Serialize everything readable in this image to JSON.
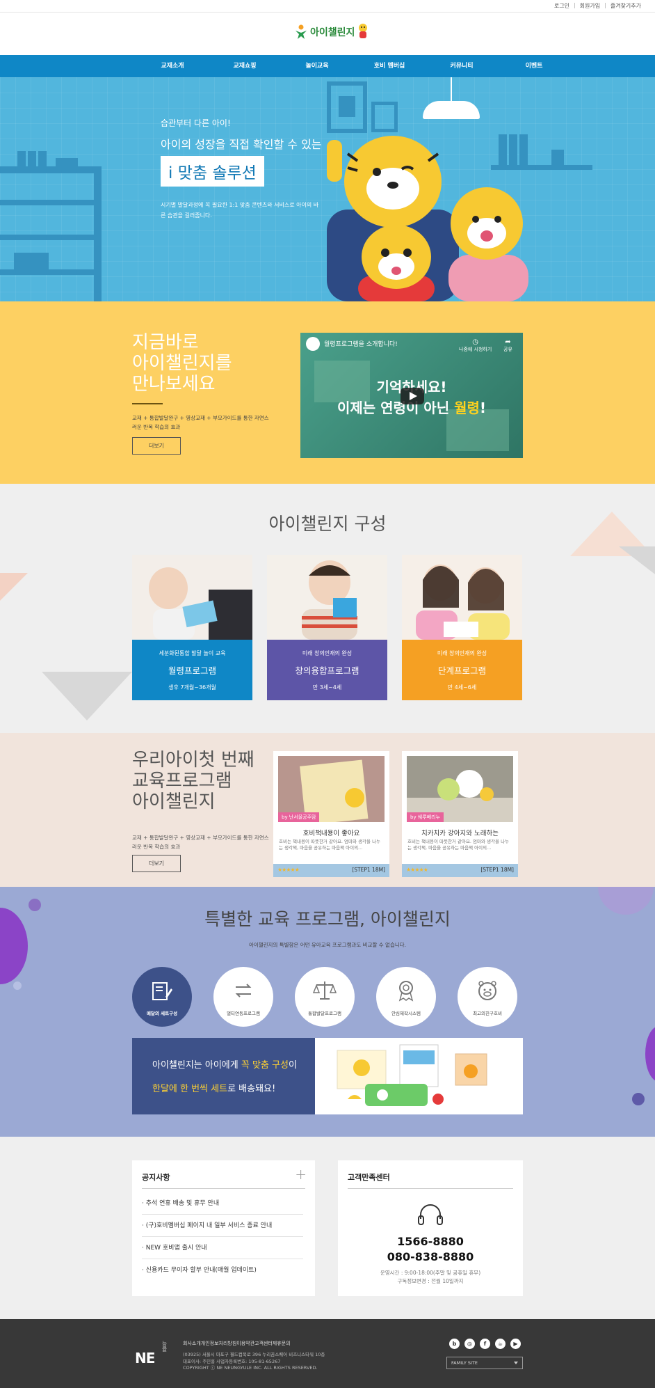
{
  "util": {
    "login": "로그인",
    "join": "회원가입",
    "bookmark": "즐겨찾기추가"
  },
  "logo": {
    "text": "아이챌린지"
  },
  "nav": {
    "items": [
      "교재소개",
      "교재쇼핑",
      "놀이교육",
      "호비 멤버십",
      "커뮤니티",
      "이벤트"
    ]
  },
  "hero": {
    "sub1": "습관부터 다른 아이!",
    "sub2": "아이의 성장을 직접 확인할 수 있는",
    "box": "i 맞춤 솔루션",
    "desc": "시기별 발달과정에 꼭 필요한 1:1 맞춤 콘텐츠와 서비스로 아이의 바른 습관을 길러줍니다."
  },
  "video_section": {
    "title_lines": [
      "지금바로",
      "아이챌린지를",
      "만나보세요"
    ],
    "desc": "교재 + 통합발달완구 + 영상교재 + 부모가이드를 통한 자연스러운 반복 학습의 효과",
    "more": "더보기",
    "video": {
      "title": "월령프로그램을 소개합니다!",
      "watch_later": "나중에 시청하기",
      "share": "공유",
      "big_line1": "기억하세요!",
      "big_line2_a": "이제는 연령이 아닌 ",
      "big_line2_b": "월령",
      "big_line2_c": "!"
    }
  },
  "composition": {
    "title": "아이챌린지 구성",
    "cards": [
      {
        "sub": "세분화된통합 발달 놀이 교육",
        "name": "월령프로그램",
        "age": "생후 7개월~36개월",
        "color": "#0f87c6"
      },
      {
        "sub": "미래 창의인재의 완성",
        "name": "창의융합프로그램",
        "age": "만 3세~4세",
        "color": "#5d55a7"
      },
      {
        "sub": "미래 창의인재의 완성",
        "name": "단계프로그램",
        "age": "만 4세~6세",
        "color": "#f5a023"
      }
    ]
  },
  "first_program": {
    "title_lines": [
      "우리아이첫 번째",
      "교육프로그램",
      "아이챌린지"
    ],
    "desc": "교재 + 통합발달완구 + 영상교재 + 부모가이드를 통한 자연스러운 반복 학습의 효과",
    "more": "더보기",
    "books": [
      {
        "tag": "by 난서울공주맘",
        "title": "호비책내용이 좋아요",
        "desc": "호비는 책내용이 따뜻한거 같아요. 엄마와 생각을 나누는 생각책, 마음을 공유하는 마음책 아이의...",
        "stars": "★★★★★",
        "step": "[STEP1 18M]"
      },
      {
        "tag": "by 쉐루베리누",
        "title": "치카치카 강아지와 노래하는",
        "desc": "호비는 책내용이 따뜻한거 같아요. 엄마와 생각을 나누는 생각책, 마음을 공유하는 마음책 아이의...",
        "stars": "★★★★★",
        "step": "[STEP1 18M]"
      }
    ]
  },
  "special": {
    "title": "특별한 교육 프로그램, 아이챌린지",
    "subtitle": "아이챌린지의 특별함은 어떤 유아교육 프로그램과도 비교할 수 없습니다.",
    "features": [
      "매달의 세트구성",
      "멀티연동프로그램",
      "통합발달프로그램",
      "안심제작시스템",
      "최고의친구호비"
    ],
    "banner_l1_a": "아이챌린지는 아이에게 ",
    "banner_l1_b": "꼭 맞춤 구성",
    "banner_l1_c": "이",
    "banner_l2_a": "한달에 한 번씩 세트",
    "banner_l2_b": "로 배송돼요!"
  },
  "notice": {
    "title": "공지사항",
    "plus": "+",
    "items": [
      "· 추석 연휴 배송 및 휴무 안내",
      "· (구)호비멤버십 페이지 내 일부 서비스 종료 안내",
      "· NEW 호비앱 출시 안내",
      "· 신용카드 무이자 할부 안내(매월 업데이트)"
    ]
  },
  "cs": {
    "title": "고객만족센터",
    "phone1": "1566-8880",
    "phone2": "080-838-8880",
    "hours": "운영시간 : 9:00-18:00(주말 및 공휴일 휴무)",
    "change": "구독정보변경 : 전월 10일까지"
  },
  "footer": {
    "logo": "NE",
    "logo_sub": "능률",
    "links": "회사소개개인정보처리방침이용약관고객센터제휴문의",
    "addr1": "(03925) 서울시 마포구 월드컵북로 396 누리꿈스퀘어 비즈니스타워 10층",
    "addr2": "대표이사: 주민홍 사업자등록번호: 105-81-65267",
    "copyright": "COPYRIGHT ⓒ NE NEUNGYULE INC. ALL RIGHTS RESERVED.",
    "sns": [
      "b",
      "◎",
      "f",
      "☕",
      "▶"
    ],
    "family": "FAMILY SITE"
  }
}
